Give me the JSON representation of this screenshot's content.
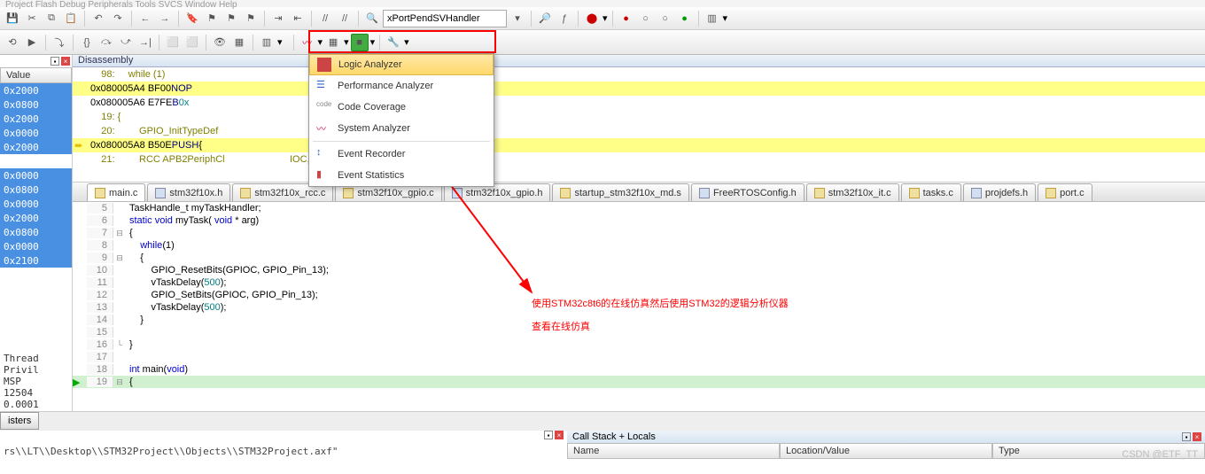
{
  "menu_hint": "Project  Flash  Debug  Peripherals  Tools  SVCS  Window  Help",
  "combo_value": "xPortPendSVHandler",
  "disassembly_title": "Disassembly",
  "value_header": "Value",
  "left_addrs": [
    "0x2000",
    "0x0800",
    "0x2000",
    "0x0000",
    "0x2000",
    "",
    "0x0000",
    "0x0800",
    "0x0000",
    "0x2000",
    "0x0800",
    "0x0000",
    "0x2100"
  ],
  "left_footer": [
    "Thread",
    "Privil",
    "MSP",
    "12504",
    "0.0001"
  ],
  "dis": {
    "l1": "    98:     while (1)",
    "l2_a": "0x080005A4 BF00",
    "l2_b": "NOP",
    "l3_a": "0x080005A6 E7FE",
    "l3_b": "B",
    "l3_c": "0x",
    "l4": "    19: {",
    "l5": "    20:         GPIO_InitTypeDef",
    "l6_a": "0x080005A8 B50E",
    "l6_b": "PUSH",
    "l6_c": "{",
    "l7": "    21:         RCC APB2PeriphCl                        IOC, ENABLE);"
  },
  "dropdown": {
    "logic": "Logic Analyzer",
    "perf": "Performance Analyzer",
    "cov": "Code Coverage",
    "sys": "System Analyzer",
    "evtrec": "Event Recorder",
    "evtstat": "Event Statistics"
  },
  "tabs": [
    "main.c",
    "stm32f10x.h",
    "stm32f10x_rcc.c",
    "stm32f10x_gpio.c",
    "stm32f10x_gpio.h",
    "startup_stm32f10x_md.s",
    "FreeRTOSConfig.h",
    "stm32f10x_it.c",
    "tasks.c",
    "projdefs.h",
    "port.c"
  ],
  "editor": [
    {
      "n": "5",
      "t": "TaskHandle_t myTaskHandler;",
      "raw": true
    },
    {
      "n": "6",
      "t": "static void myTask( void * arg)",
      "raw": true
    },
    {
      "n": "7",
      "t": "{",
      "fold": "⊟"
    },
    {
      "n": "8",
      "t": "    while(1)",
      "kw": "while"
    },
    {
      "n": "9",
      "t": "    {",
      "fold": "⊟"
    },
    {
      "n": "10",
      "t": "        GPIO_ResetBits(GPIOC, GPIO_Pin_13);"
    },
    {
      "n": "11",
      "t": "        vTaskDelay(500);",
      "num": "500"
    },
    {
      "n": "12",
      "t": "        GPIO_SetBits(GPIOC, GPIO_Pin_13);"
    },
    {
      "n": "13",
      "t": "        vTaskDelay(500);",
      "num": "500"
    },
    {
      "n": "14",
      "t": "    }"
    },
    {
      "n": "15",
      "t": ""
    },
    {
      "n": "16",
      "t": "}",
      "fold": "└"
    },
    {
      "n": "17",
      "t": ""
    },
    {
      "n": "18",
      "t": "int main(void)",
      "kw": "int"
    },
    {
      "n": "19",
      "t": "{",
      "fold": "⊟",
      "hl": true
    }
  ],
  "annot_l1": "使用STM32c8t6的在线仿真然后使用STM32的逻辑分析仪器",
  "annot_l2": "查看在线仿真",
  "bottom_left_tab": "isters",
  "bottom_path": "rs\\\\LT\\\\Desktop\\\\STM32Project\\\\Objects\\\\STM32Project.axf\"",
  "callstack_title": "Call Stack + Locals",
  "cs_cols": [
    "Name",
    "Location/Value",
    "Type"
  ],
  "watermark": "CSDN @ETF_TT"
}
